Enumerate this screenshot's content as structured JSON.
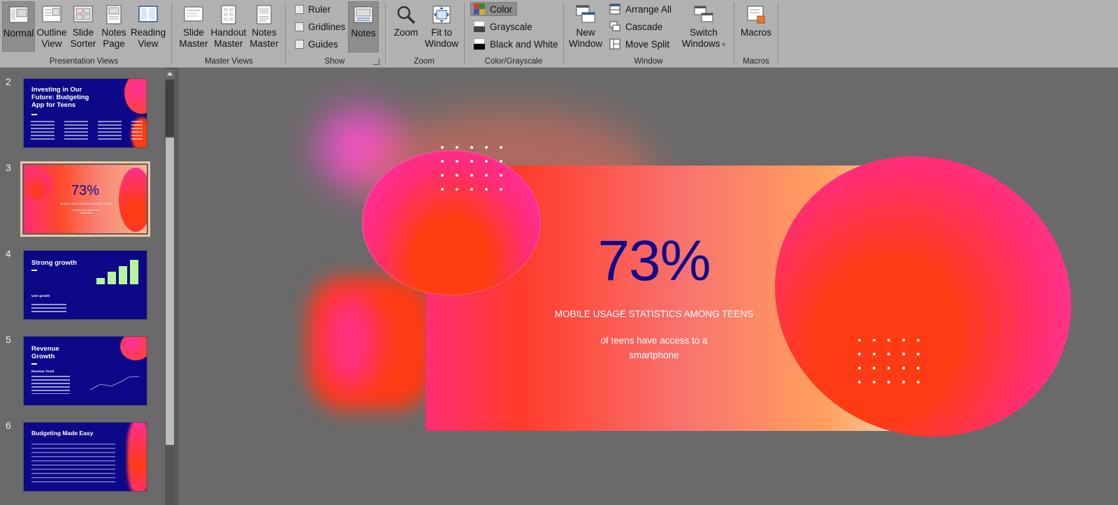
{
  "ribbon": {
    "presentation_views": {
      "label": "Presentation Views",
      "buttons": [
        {
          "l1": "Normal",
          "l2": ""
        },
        {
          "l1": "Outline",
          "l2": "View"
        },
        {
          "l1": "Slide",
          "l2": "Sorter"
        },
        {
          "l1": "Notes",
          "l2": "Page"
        },
        {
          "l1": "Reading",
          "l2": "View"
        }
      ]
    },
    "master_views": {
      "label": "Master Views",
      "buttons": [
        {
          "l1": "Slide",
          "l2": "Master"
        },
        {
          "l1": "Handout",
          "l2": "Master"
        },
        {
          "l1": "Notes",
          "l2": "Master"
        }
      ]
    },
    "show": {
      "label": "Show",
      "checkboxes": [
        "Ruler",
        "Gridlines",
        "Guides"
      ],
      "notes_label": "Notes"
    },
    "zoom": {
      "label": "Zoom",
      "zoom_label": "Zoom",
      "fit_l1": "Fit to",
      "fit_l2": "Window"
    },
    "color_grayscale": {
      "label": "Color/Grayscale",
      "options": [
        "Color",
        "Grayscale",
        "Black and White"
      ]
    },
    "window": {
      "label": "Window",
      "new_l1": "New",
      "new_l2": "Window",
      "arrange_all": "Arrange All",
      "cascade": "Cascade",
      "move_split": "Move Split",
      "switch_l1": "Switch",
      "switch_l2": "Windows"
    },
    "macros": {
      "label": "Macros",
      "button": "Macros"
    }
  },
  "thumbnails": [
    {
      "num": "2",
      "title": "Investing in Our Future: Budgeting App for Teens"
    },
    {
      "num": "3",
      "title": "73%",
      "sub": "MOBILE USAGE STATISTICS AMONG TEENS",
      "desc": "of teens have access to a smartphone"
    },
    {
      "num": "4",
      "title": "Strong growth",
      "sub": "User growth"
    },
    {
      "num": "5",
      "title": "Revenue Growth",
      "sub": "Revenue Trend"
    },
    {
      "num": "6",
      "title": "Budgeting Made Easy"
    }
  ],
  "slide": {
    "big_number": "73%",
    "subtitle": "MOBILE USAGE STATISTICS AMONG TEENS",
    "desc_line1": "of teens have access to a",
    "desc_line2": "smartphone"
  },
  "colors": {
    "ribbon_bg": "#b1b1b1",
    "canvas_bg": "#6a6a6a",
    "slide_navy": "#0c0887",
    "accent_pink": "#ff2d9a",
    "accent_orange": "#ff3b14"
  }
}
